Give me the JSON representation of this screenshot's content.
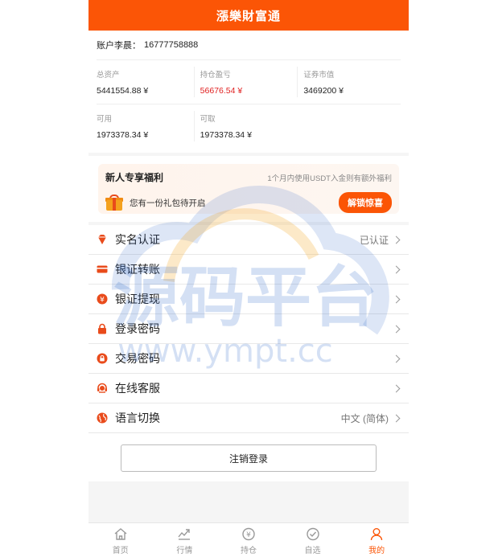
{
  "header": {
    "title": "漲樂財富通"
  },
  "account": {
    "label": "账户李晨：",
    "number": "16777758888"
  },
  "stats": [
    {
      "title": "总资产",
      "value": "5441554.88 ¥"
    },
    {
      "title": "持仓盈亏",
      "value": "56676.54 ¥"
    },
    {
      "title": "证券市值",
      "value": "3469200 ¥"
    },
    {
      "title": "可用",
      "value": "1973378.34 ¥"
    },
    {
      "title": "可取",
      "value": "1973378.34 ¥"
    }
  ],
  "welfare": {
    "title": "新人专享福利",
    "note": "1个月内使用USDT入金则有额外福利",
    "gift_text": "您有一份礼包待开启",
    "button": "解锁惊喜"
  },
  "menu": [
    {
      "label": "实名认证",
      "value": "已认证",
      "icon": "diamond-icon"
    },
    {
      "label": "银证转账",
      "value": "",
      "icon": "card-icon"
    },
    {
      "label": "银证提现",
      "value": "",
      "icon": "yen-icon"
    },
    {
      "label": "登录密码",
      "value": "",
      "icon": "lock-icon"
    },
    {
      "label": "交易密码",
      "value": "",
      "icon": "lock-circle-icon"
    },
    {
      "label": "在线客服",
      "value": "",
      "icon": "headset-icon"
    },
    {
      "label": "语言切换",
      "value": "中文 (简体)",
      "icon": "globe-icon"
    }
  ],
  "logout": "注销登录",
  "tabs": [
    {
      "label": "首页",
      "icon": "home-icon"
    },
    {
      "label": "行情",
      "icon": "chart-icon"
    },
    {
      "label": "持仓",
      "icon": "position-icon"
    },
    {
      "label": "自选",
      "icon": "check-circle-icon"
    },
    {
      "label": "我的",
      "icon": "user-icon",
      "active": true
    }
  ],
  "watermark": {
    "text": "源码平台",
    "url": "www.ympt.cc"
  },
  "colors": {
    "brand": "#fb5506",
    "loss_red": "#e02020"
  }
}
